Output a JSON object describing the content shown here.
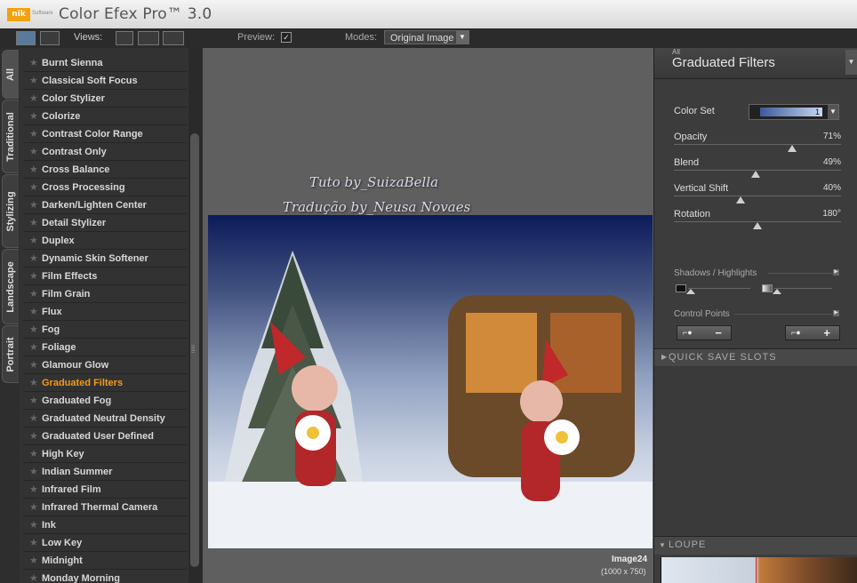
{
  "app": {
    "title": "Color Efex Pro™ 3.0",
    "logo_text": "nik",
    "logo_sub": "Software"
  },
  "toolbar": {
    "views_label": "Views:",
    "preview_label": "Preview:",
    "preview_checked": "✓",
    "modes_label": "Modes:",
    "modes_value": "Original Image"
  },
  "tabs": [
    {
      "label": "All"
    },
    {
      "label": "Traditional"
    },
    {
      "label": "Stylizing"
    },
    {
      "label": "Landscape"
    },
    {
      "label": "Portrait"
    }
  ],
  "filters": [
    "Burnt Sienna",
    "Classical Soft Focus",
    "Color Stylizer",
    "Colorize",
    "Contrast Color Range",
    "Contrast Only",
    "Cross Balance",
    "Cross Processing",
    "Darken/Lighten Center",
    "Detail Stylizer",
    "Duplex",
    "Dynamic Skin Softener",
    "Film Effects",
    "Film Grain",
    "Flux",
    "Fog",
    "Foliage",
    "Glamour Glow",
    "Graduated Filters",
    "Graduated Fog",
    "Graduated Neutral Density",
    "Graduated User Defined",
    "High Key",
    "Indian Summer",
    "Infrared Film",
    "Infrared Thermal Camera",
    "Ink",
    "Low Key",
    "Midnight",
    "Monday Morning"
  ],
  "active_filter": "Graduated Filters",
  "canvas": {
    "watermark_line1": "Tuto by_SuizaBella",
    "watermark_line2": "Tradução by_Neusa Novaes",
    "image_label": "Image24",
    "image_size": "(1000 x 750)"
  },
  "panel": {
    "category": "All",
    "title": "Graduated Filters",
    "color_set_label": "Color Set",
    "color_set_value": "1",
    "controls": [
      {
        "label": "Opacity",
        "value": "71%",
        "level": 0.71
      },
      {
        "label": "Blend",
        "value": "49%",
        "level": 0.49
      },
      {
        "label": "Vertical Shift",
        "value": "40%",
        "level": 0.4
      },
      {
        "label": "Rotation",
        "value": "180°",
        "level": 0.5
      }
    ],
    "shadows_highlights": "Shadows / Highlights",
    "control_points": "Control Points",
    "quick_save": "QUICK SAVE SLOTS",
    "loupe": "LOUPE"
  },
  "colors": {
    "accent": "#f29b1b",
    "background": "#323232"
  }
}
